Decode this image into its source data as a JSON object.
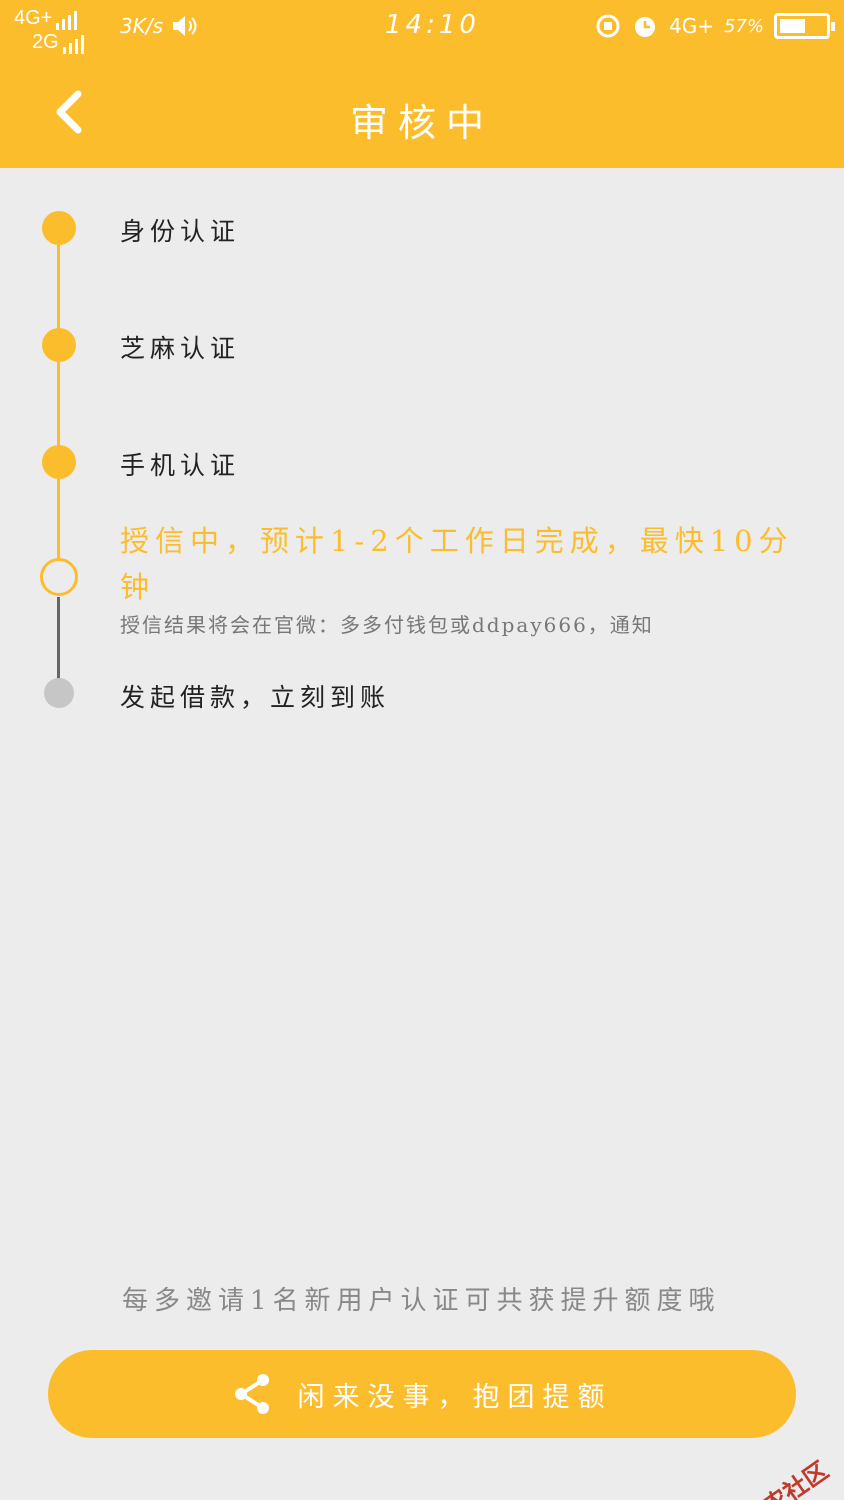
{
  "status_bar": {
    "signal_top": "4G+",
    "signal_bottom": "2G",
    "speed": "3K/s",
    "time": "14:10",
    "network": "4G+",
    "battery": "57%",
    "battery_level": 0.57
  },
  "header": {
    "title": "审核中",
    "back_icon": "chevron-left-icon"
  },
  "timeline": {
    "steps": [
      {
        "label": "身份认证",
        "state": "done"
      },
      {
        "label": "芝麻认证",
        "state": "done"
      },
      {
        "label": "手机认证",
        "state": "done"
      },
      {
        "label": "授信中，预计1-2个工作日完成，最快10分钟",
        "state": "current"
      },
      {
        "label": "发起借款，立刻到账",
        "state": "pending"
      }
    ],
    "current_note": "授信结果将会在官微：多多付钱包或ddpay666，通知"
  },
  "invite_text": "每多邀请1名新用户认证可共获提升额度哦",
  "cta": {
    "label": "闲来没事，抱团提额",
    "icon": "share-icon"
  },
  "watermark": "卡农社区",
  "colors": {
    "accent": "#fcbd2d",
    "background": "#ececec",
    "pending": "#c6c6c6"
  }
}
